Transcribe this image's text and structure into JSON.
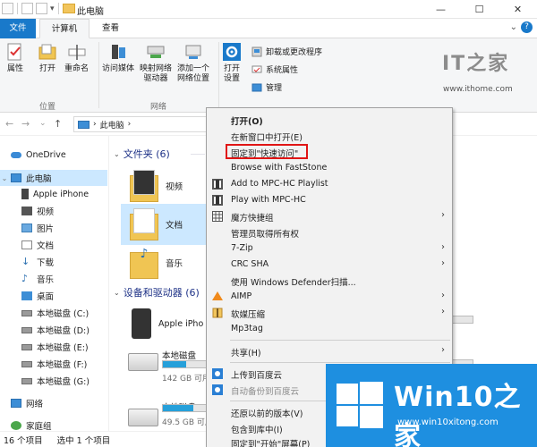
{
  "window": {
    "title": "此电脑",
    "controls": {
      "minimize": "—",
      "maximize": "☐",
      "close": "✕"
    }
  },
  "tabs": {
    "file": "文件",
    "computer": "计算机",
    "view": "查看",
    "expand": "⌄",
    "help": "?"
  },
  "ribbon": {
    "properties": "属性",
    "open": "打开",
    "rename": "重命名",
    "location_group": "位置",
    "access_media": "访问媒体",
    "map_drive_1": "映射网络",
    "map_drive_2": "驱动器",
    "add_location_1": "添加一个",
    "add_location_2": "网络位置",
    "network_group": "网络",
    "open_settings_1": "打开",
    "open_settings_2": "设置",
    "uninstall": "卸载或更改程序",
    "system_properties": "系统属性",
    "manage": "管理",
    "logo_text": "IT之家",
    "logo_url": "www.ithome.com"
  },
  "address": {
    "back": "←",
    "forward": "→",
    "down": "⌄",
    "up": "↑",
    "path_root": "›",
    "path": "此电脑",
    "sep": "›"
  },
  "sidebar": {
    "items": [
      {
        "label": "OneDrive"
      },
      {
        "label": "此电脑"
      },
      {
        "label": "Apple iPhone"
      },
      {
        "label": "视频"
      },
      {
        "label": "图片"
      },
      {
        "label": "文档"
      },
      {
        "label": "下载"
      },
      {
        "label": "音乐"
      },
      {
        "label": "桌面"
      },
      {
        "label": "本地磁盘 (C:)"
      },
      {
        "label": "本地磁盘 (D:)"
      },
      {
        "label": "本地磁盘 (E:)"
      },
      {
        "label": "本地磁盘 (F:)"
      },
      {
        "label": "本地磁盘 (G:)"
      },
      {
        "label": "网络"
      },
      {
        "label": "家庭组"
      }
    ]
  },
  "content": {
    "folders_header": "文件夹 (6)",
    "folders": [
      {
        "label": "视频"
      },
      {
        "label": "文档"
      },
      {
        "label": "音乐"
      }
    ],
    "devices_header": "设备和驱动器 (6)",
    "iphone_label": "Apple iPho",
    "drives": [
      {
        "label": "本地磁盘",
        "free_text": "142 GB 可用",
        "fill": 0.55
      },
      {
        "label": "本地磁盘",
        "free_text": "49.5 GB 可用",
        "fill": 0.7
      }
    ]
  },
  "status": {
    "items": "16 个项目",
    "selected": "选中 1 个项目"
  },
  "context_menu": {
    "items": [
      {
        "label": "打开(O)",
        "bold": true
      },
      {
        "label": "在新窗口中打开(E)"
      },
      {
        "label": "固定到\"快速访问\""
      },
      {
        "label": "Browse with FastStone"
      },
      {
        "label": "Add to MPC-HC Playlist"
      },
      {
        "label": "Play with MPC-HC"
      },
      {
        "label": "魔方快捷组",
        "submenu": true
      },
      {
        "label": "管理员取得所有权"
      },
      {
        "label": "7-Zip",
        "submenu": true
      },
      {
        "label": "CRC SHA",
        "submenu": true
      },
      {
        "label": "使用 Windows Defender扫描..."
      },
      {
        "label": "AIMP",
        "submenu": true
      },
      {
        "label": "软媒压缩",
        "submenu": true
      },
      {
        "label": "Mp3tag"
      },
      {
        "label": "共享(H)",
        "submenu": true
      },
      {
        "label": "上传到百度云"
      },
      {
        "label": "自动备份到百度云",
        "disabled": true
      },
      {
        "label": "还原以前的版本(V)"
      },
      {
        "label": "包含到库中(I)",
        "submenu": true
      },
      {
        "label": "固定到\"开始\"屏幕(P)"
      }
    ],
    "submenu_arrow": "›"
  },
  "watermark": {
    "brand": "Win10之家",
    "url": "www.win10xitong.com"
  },
  "colors": {
    "accent": "#1979ca",
    "selection": "#cce8ff",
    "highlight_box": "#e01515",
    "watermark_bg": "#1e8fe0"
  }
}
